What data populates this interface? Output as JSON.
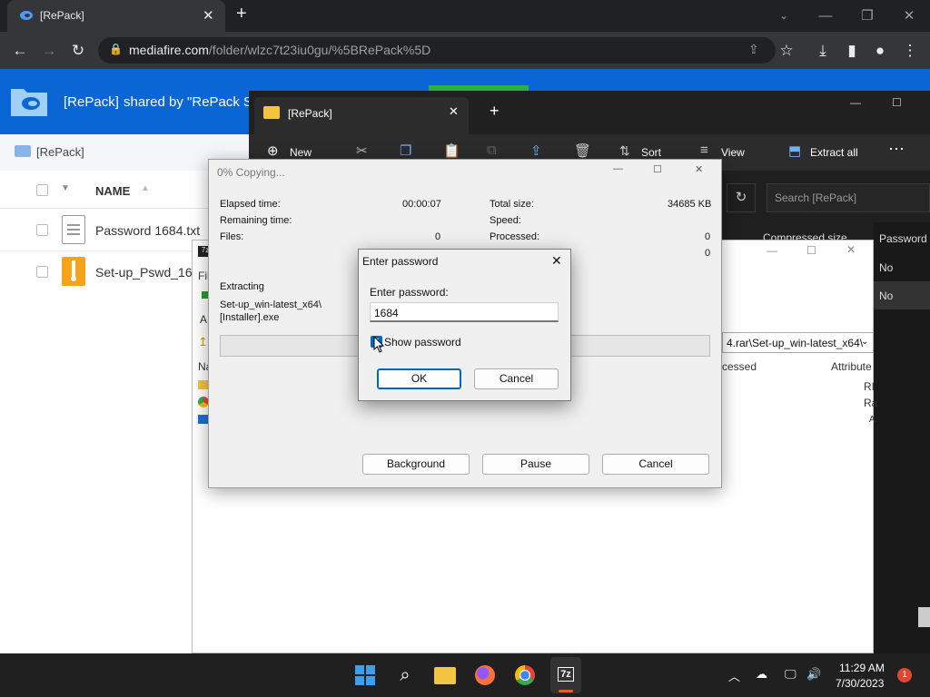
{
  "browser": {
    "tab_title": "[RePack]",
    "url_domain": "mediafire.com",
    "url_path": "/folder/wlzc7t23iu0gu/%5BRePack%5D"
  },
  "mediafire": {
    "folder_title": "[RePack]",
    "shared_by": "shared by \"RePack S0",
    "breadcrumb": "[RePack]",
    "column_name": "NAME",
    "files": [
      {
        "name": "Password 1684.txt"
      },
      {
        "name": "Set-up_Pswd_16"
      }
    ]
  },
  "explorer": {
    "tab_title": "[RePack]",
    "cmd_new": "New",
    "cmd_sort": "Sort",
    "cmd_view": "View",
    "cmd_extract": "Extract all",
    "search_placeholder": "Search [RePack]",
    "col_compressed": "Compressed size",
    "col_password": "Password ...",
    "password_values": [
      "No",
      "No"
    ]
  },
  "sevenzip": {
    "path_fragment": "4.rar\\Set-up_win-latest_x64\\",
    "col_processed": "cessed",
    "col_attributes": "Attribute",
    "fi_label": "Fil",
    "na_label": "Na",
    "ad_label": "A",
    "attr_r1": "RI",
    "attr_r2": "Ra",
    "attr_r3": "A"
  },
  "copy_dialog": {
    "title": "0% Copying...",
    "elapsed_label": "Elapsed time:",
    "elapsed_value": "00:00:07",
    "remaining_label": "Remaining time:",
    "files_label": "Files:",
    "files_value": "0",
    "total_label": "Total size:",
    "total_value": "34685 KB",
    "speed_label": "Speed:",
    "processed_label": "Processed:",
    "processed_value": "0",
    "fourth_value": "0",
    "extracting_label": "Extracting",
    "extract_path_1": "Set-up_win-latest_x64\\",
    "extract_path_2": "[Installer].exe",
    "progress_fraction": 0,
    "background_btn": "Background",
    "pause_btn": "Pause",
    "cancel_btn": "Cancel"
  },
  "password_dialog": {
    "title": "Enter password",
    "field_label": "Enter password:",
    "field_value": "1684",
    "show_password_label": "Show password",
    "show_password_checked": true,
    "ok_btn": "OK",
    "cancel_btn": "Cancel"
  },
  "taskbar": {
    "time": "11:29 AM",
    "date": "7/30/2023",
    "notification_count": "1"
  },
  "colors": {
    "mediafire_blue": "#0a66d4",
    "chrome_dark": "#202124",
    "accent_button": "#0067c0"
  }
}
